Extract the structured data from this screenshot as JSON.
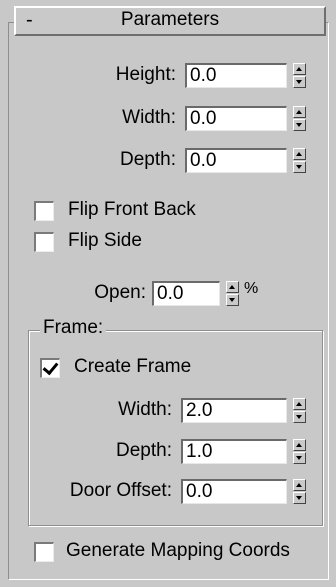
{
  "rollout": {
    "collapse_symbol": "-",
    "title": "Parameters"
  },
  "params": {
    "height": {
      "label": "Height:",
      "value": "0.0"
    },
    "width": {
      "label": "Width:",
      "value": "0.0"
    },
    "depth": {
      "label": "Depth:",
      "value": "0.0"
    },
    "flip_front_back": {
      "label": "Flip Front Back",
      "checked": false
    },
    "flip_side": {
      "label": "Flip Side",
      "checked": false
    },
    "open": {
      "label": "Open:",
      "value": "0.0",
      "unit": "%"
    }
  },
  "frame": {
    "group_label": "Frame:",
    "create_frame": {
      "label": "Create Frame",
      "checked": true
    },
    "width": {
      "label": "Width:",
      "value": "2.0"
    },
    "depth": {
      "label": "Depth:",
      "value": "1.0"
    },
    "door_offset": {
      "label": "Door Offset:",
      "value": "0.0"
    }
  },
  "generate_mapping": {
    "label": "Generate Mapping Coords",
    "checked": false
  },
  "icons": {
    "spinner": "spinner-arrows-icon",
    "checkmark": "checkmark-icon"
  }
}
